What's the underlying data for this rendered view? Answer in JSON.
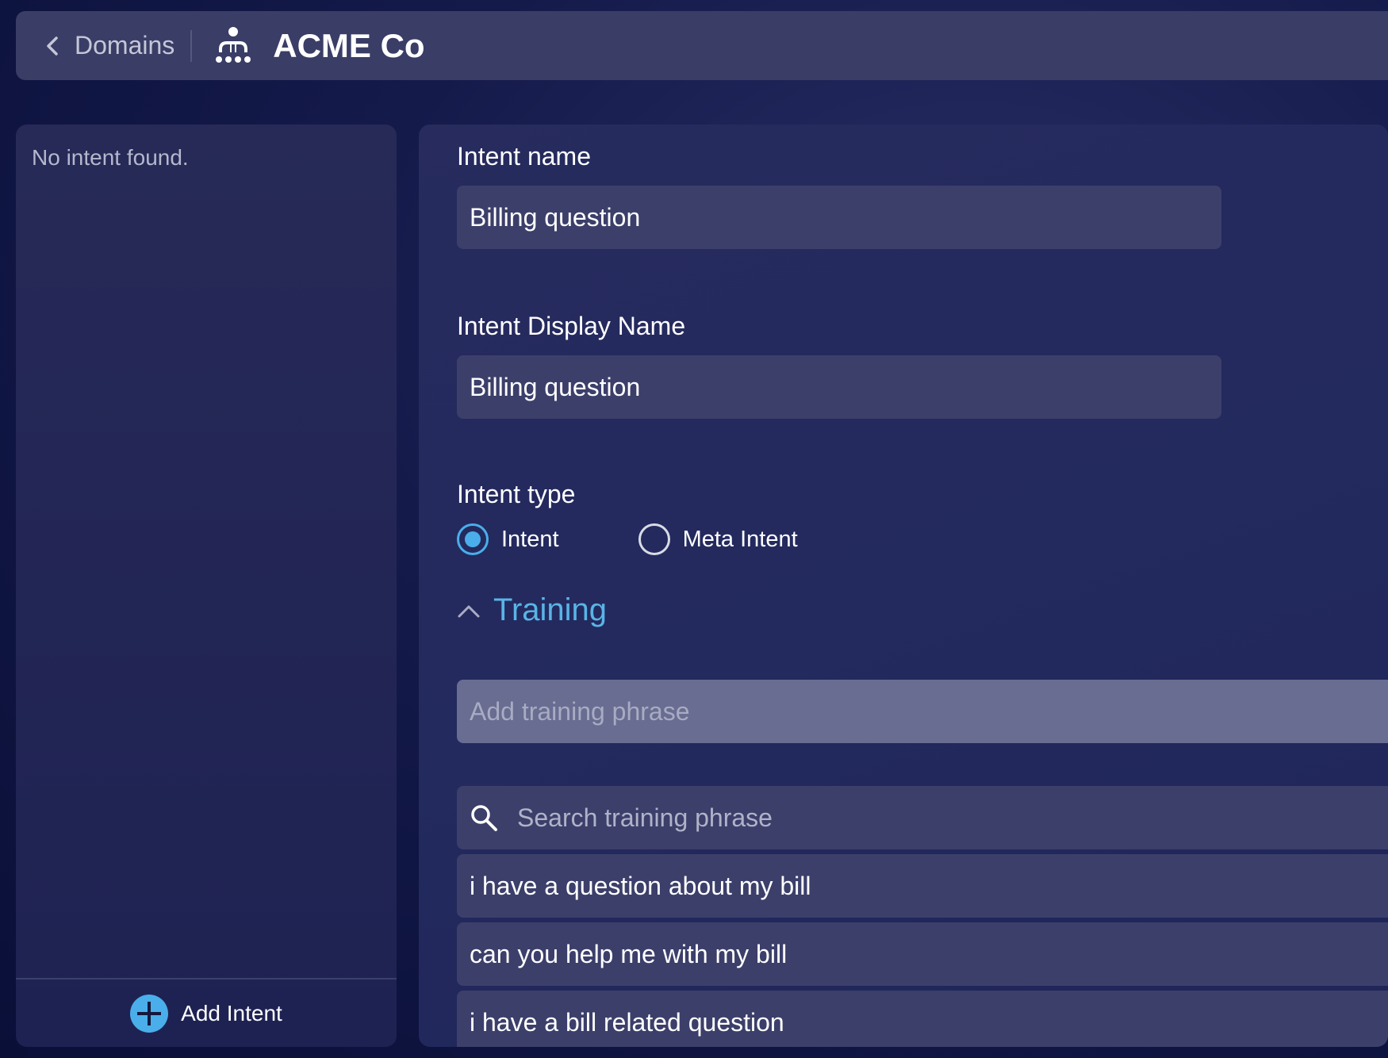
{
  "header": {
    "back_label": "Domains",
    "org_name": "ACME Co"
  },
  "sidebar": {
    "empty_message": "No intent found.",
    "add_intent_label": "Add Intent"
  },
  "form": {
    "intent_name_label": "Intent name",
    "intent_name_value": "Billing question",
    "display_name_label": "Intent Display Name",
    "display_name_value": "Billing question",
    "intent_type_label": "Intent type",
    "intent_type_options": [
      {
        "label": "Intent",
        "selected": true
      },
      {
        "label": "Meta Intent",
        "selected": false
      }
    ],
    "training_section_title": "Training",
    "add_phrase_placeholder": "Add training phrase",
    "search_placeholder": "Search training phrase",
    "phrases": [
      "i have a question about my bill",
      "can you help me with my bill",
      "i have a bill related question"
    ]
  },
  "colors": {
    "accent": "#4aaeea",
    "section_title": "#5ab4e6",
    "field_bg": "#3c3f6a",
    "add_phrase_bg": "#686d91"
  },
  "icons": {
    "back": "chevron-left-icon",
    "org": "organization-icon",
    "add": "plus-circle-icon",
    "collapse": "chevron-up-icon",
    "search": "search-icon"
  }
}
